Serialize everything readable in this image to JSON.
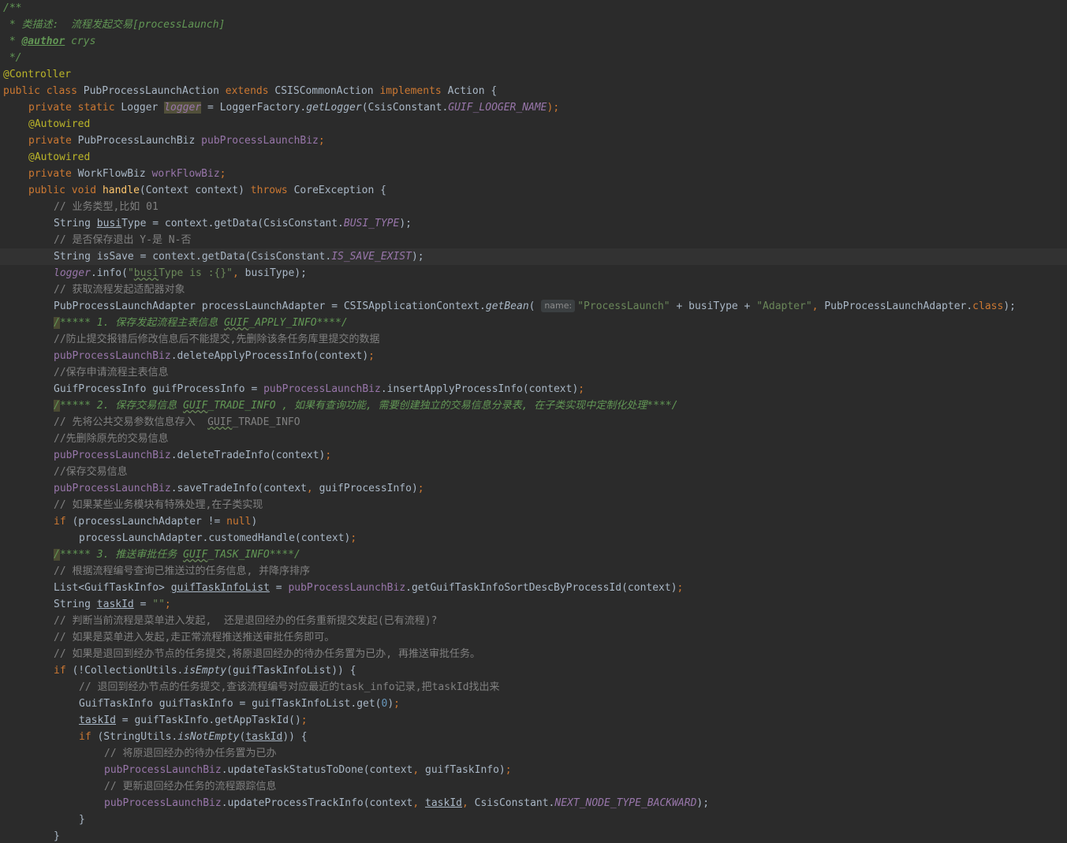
{
  "editor": {
    "lines": [
      {
        "id": "l1",
        "text": "/**"
      },
      {
        "id": "l2",
        "text": " * 类描述:  流程发起交易[processLaunch]"
      },
      {
        "id": "l3",
        "pre": " * ",
        "tag": "@author",
        "post": " crys"
      },
      {
        "id": "l4",
        "text": " */"
      },
      {
        "id": "l5",
        "text": "@Controller"
      },
      {
        "id": "l6",
        "parts": [
          "public",
          " ",
          "class",
          " PubProcessLaunchAction ",
          "extends",
          " CSISCommonAction ",
          "implements",
          " Action {"
        ]
      },
      {
        "id": "l7",
        "parts": [
          "private",
          " ",
          "static",
          " Logger ",
          "logger",
          " = LoggerFactory.",
          "getLogger",
          "(CsisConstant.",
          "GUIF_LOOGER_NAME",
          ");"
        ]
      },
      {
        "id": "l8",
        "text": "@Autowired"
      },
      {
        "id": "l9",
        "parts": [
          "private",
          " PubProcessLaunchBiz ",
          "pubProcessLaunchBiz",
          ";"
        ]
      },
      {
        "id": "l10",
        "text": "@Autowired"
      },
      {
        "id": "l11",
        "parts": [
          "private",
          " WorkFlowBiz ",
          "workFlowBiz",
          ";"
        ]
      },
      {
        "id": "l12",
        "parts": [
          "public",
          " ",
          "void",
          " ",
          "handle",
          "(Context context) ",
          "throws",
          " CoreException {"
        ]
      },
      {
        "id": "l13",
        "text": "// 业务类型,比如 01"
      },
      {
        "id": "l14",
        "parts": [
          "String ",
          "busi",
          "Type = context.getData(CsisConstant.",
          "BUSI_TYPE",
          ");"
        ]
      },
      {
        "id": "l15",
        "text": "// 是否保存退出 Y-是 N-否"
      },
      {
        "id": "l16",
        "parts": [
          "String isSave = context.getData(CsisConstant.",
          "IS_SAVE_EXIST",
          ");"
        ]
      },
      {
        "id": "l17",
        "parts": [
          "logger",
          ".info(",
          "\"",
          "busi",
          "Type is :{}\"",
          ", ",
          "busiType);"
        ]
      },
      {
        "id": "l18",
        "text": "// 获取流程发起适配器对象"
      },
      {
        "id": "l19",
        "parts": [
          "PubProcessLaunchAdapter processLaunchAdapter = CSISApplicationContext.",
          "getBean",
          "( ",
          "name:",
          "\"ProcessLaunch\"",
          " + busiType + ",
          "\"Adapter\"",
          ", ",
          "PubProcessLaunchAdapter.",
          "class",
          ");"
        ]
      },
      {
        "id": "l20",
        "parts": [
          "/",
          "***** 1. 保存发起流程主表信息 ",
          "GUIF",
          "_APPLY_INFO****/"
        ]
      },
      {
        "id": "l21",
        "text": "//防止提交报错后修改信息后不能提交,先删除该条任务库里提交的数据"
      },
      {
        "id": "l22",
        "parts": [
          "pubProcessLaunchBiz",
          ".deleteApplyProcessInfo(context)",
          ";"
        ]
      },
      {
        "id": "l23",
        "text": "//保存申请流程主表信息"
      },
      {
        "id": "l24",
        "parts": [
          "GuifProcessInfo guifProcessInfo = ",
          "pubProcessLaunchBiz",
          ".insertApplyProcessInfo(context)",
          ";"
        ]
      },
      {
        "id": "l25",
        "parts": [
          "/",
          "***** 2. 保存交易信息 ",
          "GUIF",
          "_TRADE_INFO , 如果有查询功能, 需要创建独立的交易信息分录表, 在子类实现中定制化处理****/"
        ]
      },
      {
        "id": "l26",
        "parts": [
          "// 先将公共交易参数信息存入  ",
          "GUIF",
          "_TRADE_INFO"
        ]
      },
      {
        "id": "l27",
        "text": "//先删除原先的交易信息"
      },
      {
        "id": "l28",
        "parts": [
          "pubProcessLaunchBiz",
          ".deleteTradeInfo(context)",
          ";"
        ]
      },
      {
        "id": "l29",
        "text": "//保存交易信息"
      },
      {
        "id": "l30",
        "parts": [
          "pubProcessLaunchBiz",
          ".saveTradeInfo(context",
          ", ",
          "guifProcessInfo)",
          ";"
        ]
      },
      {
        "id": "l31",
        "text": "// 如果某些业务模块有特殊处理,在子类实现"
      },
      {
        "id": "l32",
        "parts": [
          "if",
          " (processLaunchAdapter != ",
          "null",
          ")"
        ]
      },
      {
        "id": "l33",
        "parts": [
          "processLaunchAdapter.customedHandle(context)",
          ";"
        ]
      },
      {
        "id": "l34",
        "parts": [
          "/",
          "***** 3. 推送审批任务 ",
          "GUIF",
          "_TASK_INFO****/"
        ]
      },
      {
        "id": "l35",
        "text": "// 根据流程编号查询已推送过的任务信息, 并降序排序"
      },
      {
        "id": "l36",
        "parts": [
          "List<GuifTaskInfo> ",
          "guifTaskInfoList",
          " = ",
          "pubProcessLaunchBiz",
          ".getGuifTaskInfoSortDescByProcessId(context)",
          ";"
        ]
      },
      {
        "id": "l37",
        "parts": [
          "String ",
          "taskId",
          " = ",
          "\"\"",
          ";"
        ]
      },
      {
        "id": "l38",
        "text": "// 判断当前流程是菜单进入发起,  还是退回经办的任务重新提交发起(已有流程)?"
      },
      {
        "id": "l39",
        "text": "// 如果是菜单进入发起,走正常流程推送推送审批任务即可。"
      },
      {
        "id": "l40",
        "text": "// 如果是退回到经办节点的任务提交,将原退回经办的待办任务置为已办, 再推送审批任务。"
      },
      {
        "id": "l41",
        "parts": [
          "if",
          " (!CollectionUtils.",
          "isEmpty",
          "(guifTaskInfoList)) {"
        ]
      },
      {
        "id": "l42",
        "text": "// 退回到经办节点的任务提交,查该流程编号对应最近的task_info记录,把taskId找出来"
      },
      {
        "id": "l43",
        "parts": [
          "GuifTaskInfo guifTaskInfo = guifTaskInfoList.get(",
          "0",
          ")",
          ";"
        ]
      },
      {
        "id": "l44",
        "parts": [
          "taskId",
          " = guifTaskInfo.getAppTaskId()",
          ";"
        ]
      },
      {
        "id": "l45",
        "parts": [
          "if",
          " (StringUtils.",
          "isNotEmpty",
          "(",
          "taskId",
          ")) {"
        ]
      },
      {
        "id": "l46",
        "text": "// 将原退回经办的待办任务置为已办"
      },
      {
        "id": "l47",
        "parts": [
          "pubProcessLaunchBiz",
          ".updateTaskStatusToDone(context",
          ", ",
          "guifTaskInfo)",
          ";"
        ]
      },
      {
        "id": "l48",
        "text": "// 更新退回经办任务的流程跟踪信息"
      },
      {
        "id": "l49",
        "parts": [
          "pubProcessLaunchBiz",
          ".updateProcessTrackInfo(context",
          ", ",
          "taskId",
          ", ",
          "CsisConstant.",
          "NEXT_NODE_TYPE_BACKWARD",
          ");"
        ]
      },
      {
        "id": "l50",
        "text": "}"
      },
      {
        "id": "l51",
        "text": "}"
      }
    ]
  }
}
